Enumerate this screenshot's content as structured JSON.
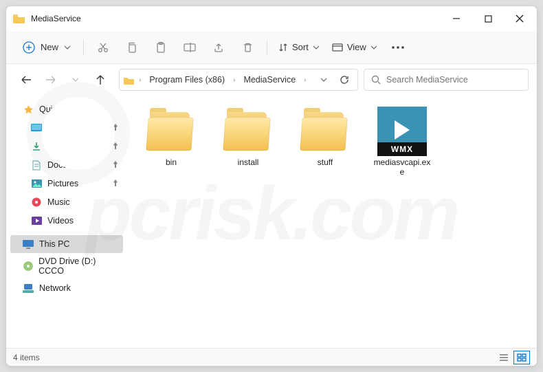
{
  "window": {
    "title": "MediaService"
  },
  "toolbar": {
    "new_label": "New",
    "sort_label": "Sort",
    "view_label": "View"
  },
  "breadcrumb": {
    "items": [
      "Program Files (x86)",
      "MediaService"
    ]
  },
  "search": {
    "placeholder": "Search MediaService"
  },
  "sidebar": {
    "quick_access": "Quick access",
    "items": [
      {
        "label": "Desktop",
        "pinned": true
      },
      {
        "label": "Downloads",
        "pinned": true
      },
      {
        "label": "Documents",
        "pinned": true
      },
      {
        "label": "Pictures",
        "pinned": true
      },
      {
        "label": "Music",
        "pinned": false
      },
      {
        "label": "Videos",
        "pinned": false
      }
    ],
    "this_pc": "This PC",
    "dvd": "DVD Drive (D:) CCCO",
    "network": "Network"
  },
  "content": {
    "items": [
      {
        "name": "bin",
        "type": "folder"
      },
      {
        "name": "install",
        "type": "folder"
      },
      {
        "name": "stuff",
        "type": "folder"
      },
      {
        "name": "mediasvcapi.exe",
        "type": "wmx",
        "badge": "WMX"
      }
    ]
  },
  "statusbar": {
    "count_label": "4 items"
  }
}
